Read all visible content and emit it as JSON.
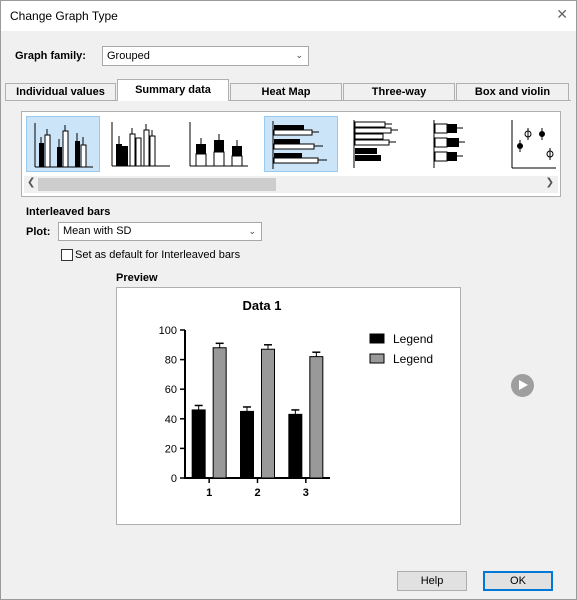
{
  "window": {
    "title": "Change Graph Type",
    "close_symbol": "✕"
  },
  "graph_family": {
    "label": "Graph family:",
    "selected": "Grouped"
  },
  "tabs": [
    {
      "label": "Individual values",
      "active": false
    },
    {
      "label": "Summary data",
      "active": true
    },
    {
      "label": "Heat Map",
      "active": false
    },
    {
      "label": "Three-way",
      "active": false
    },
    {
      "label": "Box and violin",
      "active": false
    }
  ],
  "thumbnails": [
    {
      "name": "interleaved-bars-mean-sd",
      "selected": true
    },
    {
      "name": "stacked-interleaved-bars",
      "selected": false
    },
    {
      "name": "separated-bars",
      "selected": false
    },
    {
      "name": "horizontal-interleaved-bars",
      "selected": true
    },
    {
      "name": "horizontal-stacked-bars",
      "selected": false
    },
    {
      "name": "horizontal-separated-bars",
      "selected": false
    },
    {
      "name": "grouped-points",
      "selected": false
    }
  ],
  "subtype": {
    "heading": "Interleaved bars",
    "plot_label": "Plot:",
    "plot_selected": "Mean with SD"
  },
  "default_checkbox": {
    "label": "Set as default for Interleaved bars",
    "checked": false
  },
  "preview": {
    "heading": "Preview"
  },
  "chart_data": {
    "type": "bar",
    "title": "Data 1",
    "categories": [
      "1",
      "2",
      "3"
    ],
    "series": [
      {
        "name": "Legend",
        "values": [
          46,
          45,
          43
        ],
        "errors": [
          3,
          3,
          3
        ],
        "color": "#000000"
      },
      {
        "name": "Legend",
        "values": [
          88,
          87,
          82
        ],
        "errors": [
          3,
          3,
          3
        ],
        "color": "#999999"
      }
    ],
    "ylim": [
      0,
      100
    ],
    "yticks": [
      0,
      20,
      40,
      60,
      80,
      100
    ],
    "legend": "right",
    "grid": false
  },
  "buttons": {
    "help": "Help",
    "ok": "OK"
  }
}
